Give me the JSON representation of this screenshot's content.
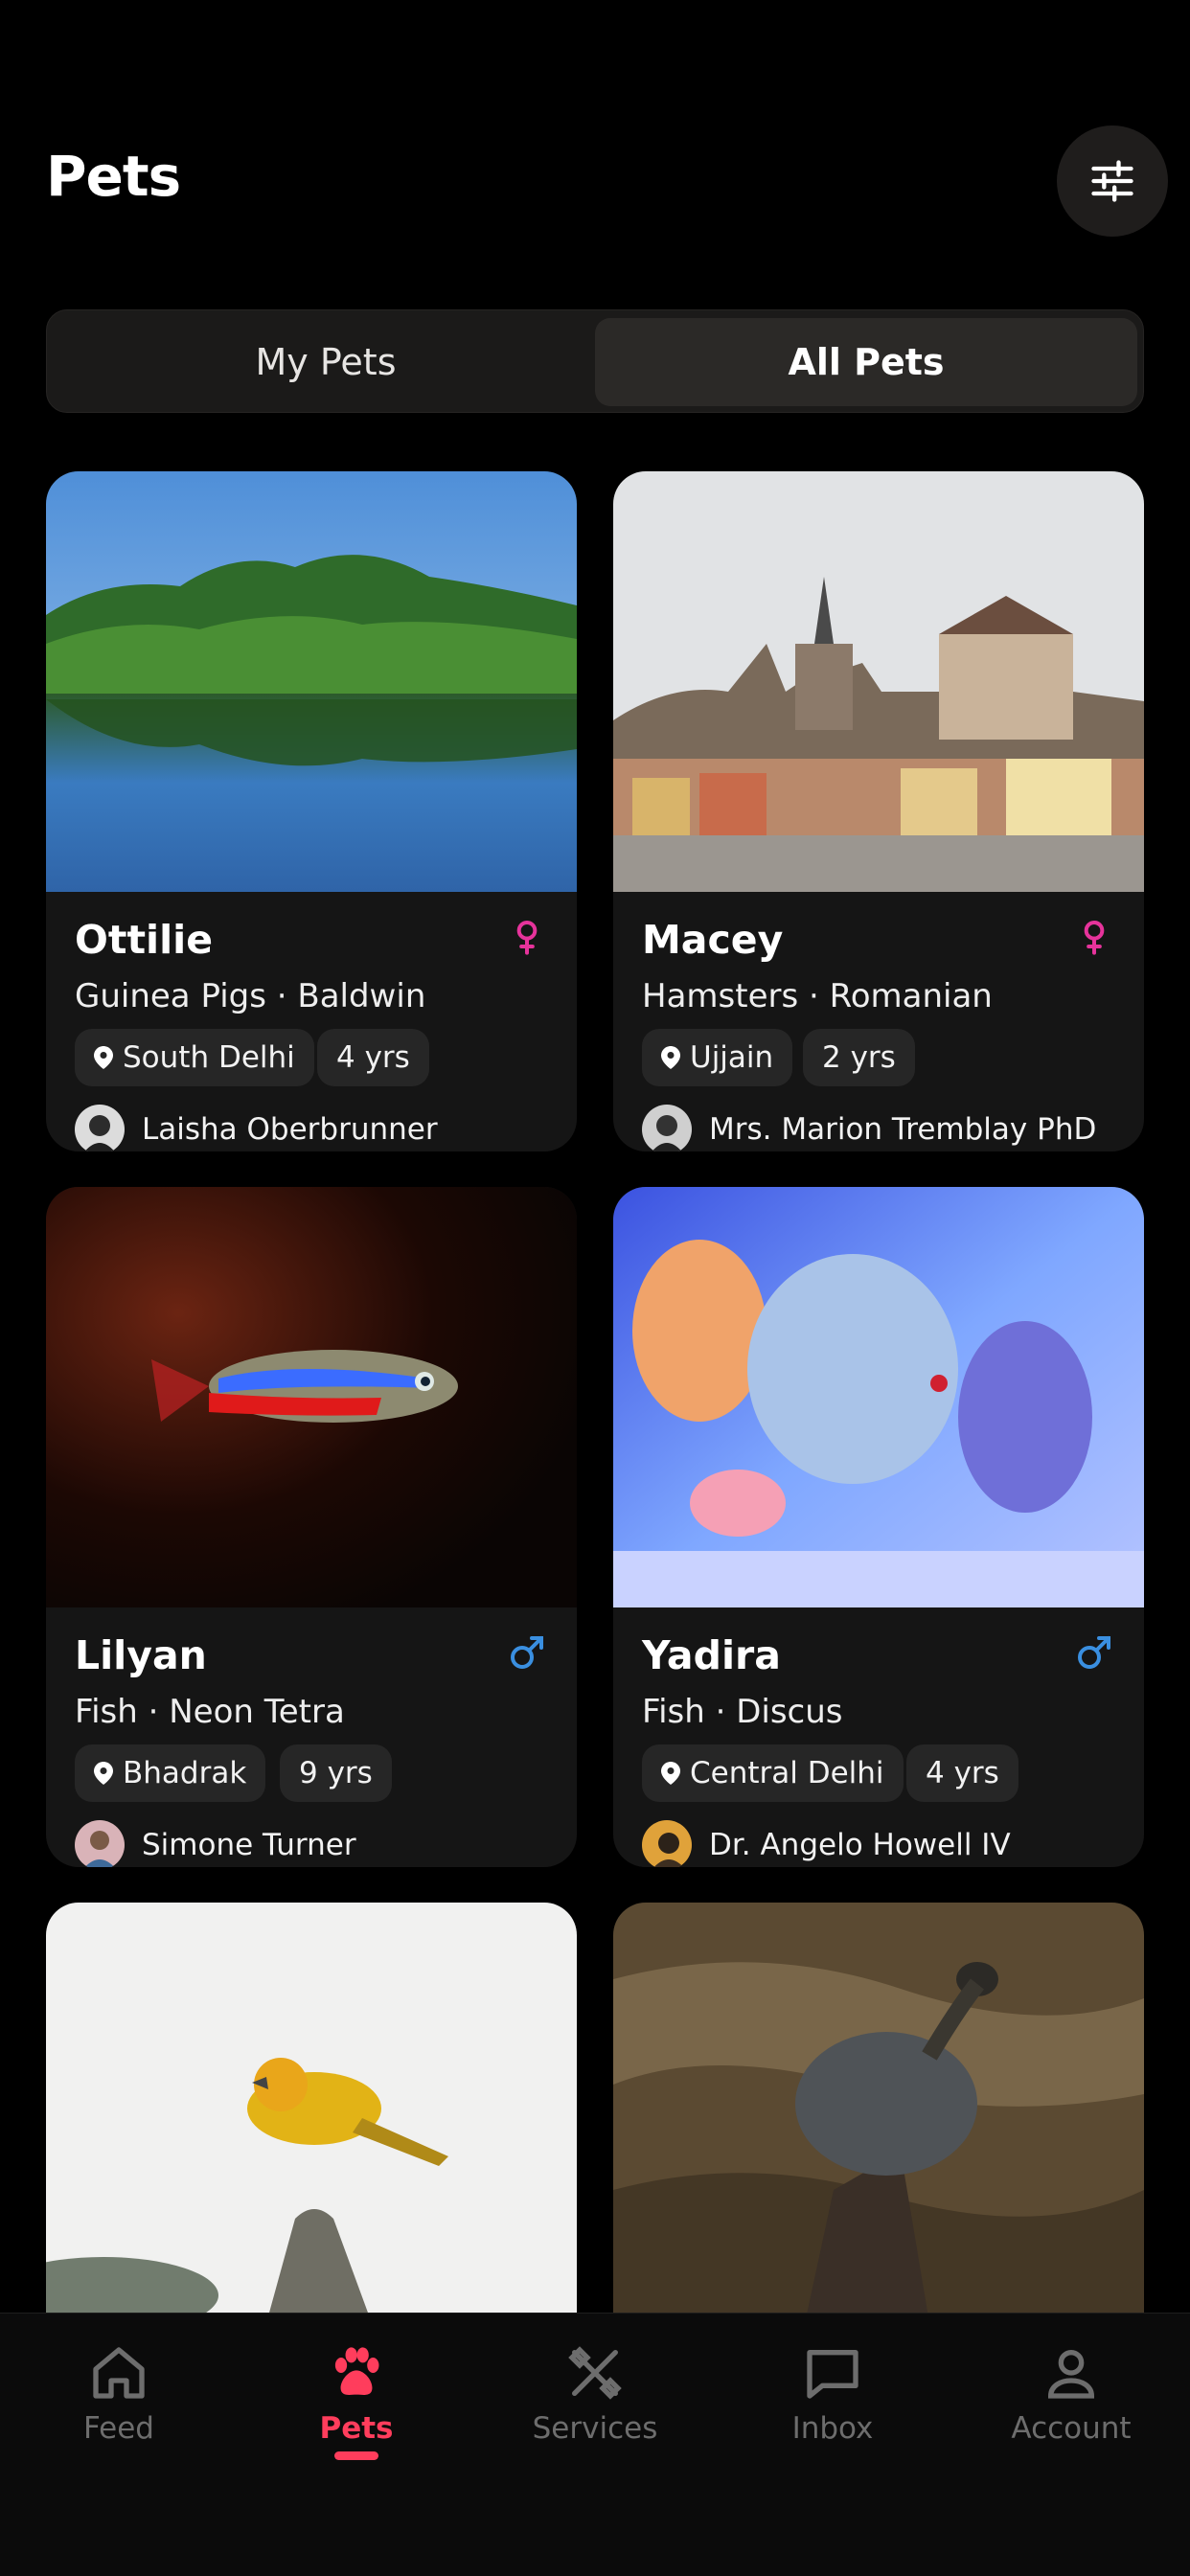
{
  "header": {
    "title": "Pets"
  },
  "filter_icon": "sliders-icon",
  "segments": {
    "left": "My Pets",
    "right": "All Pets",
    "selected": "All Pets"
  },
  "pets": [
    {
      "name": "Ottilie",
      "gender": "female",
      "breed": "Guinea Pigs · Baldwin",
      "location": "South Delhi",
      "age": "4 yrs",
      "owner": "Laisha Oberbrunner"
    },
    {
      "name": "Macey",
      "gender": "female",
      "breed": "Hamsters · Romanian",
      "location": "Ujjain",
      "age": "2 yrs",
      "owner": "Mrs. Marion Tremblay PhD"
    },
    {
      "name": "Lilyan",
      "gender": "male",
      "breed": "Fish · Neon Tetra",
      "location": "Bhadrak",
      "age": "9 yrs",
      "owner": "Simone Turner"
    },
    {
      "name": "Yadira",
      "gender": "male",
      "breed": "Fish · Discus",
      "location": "Central Delhi",
      "age": "4 yrs",
      "owner": "Dr. Angelo Howell IV"
    }
  ],
  "colors": {
    "female": "#e6339b",
    "male": "#3a8fe0",
    "accent": "#ff3d5c"
  },
  "nav": [
    {
      "label": "Feed",
      "icon": "home-icon"
    },
    {
      "label": "Pets",
      "icon": "paw-icon",
      "active": true
    },
    {
      "label": "Services",
      "icon": "tools-icon"
    },
    {
      "label": "Inbox",
      "icon": "message-icon"
    },
    {
      "label": "Account",
      "icon": "user-icon"
    }
  ]
}
